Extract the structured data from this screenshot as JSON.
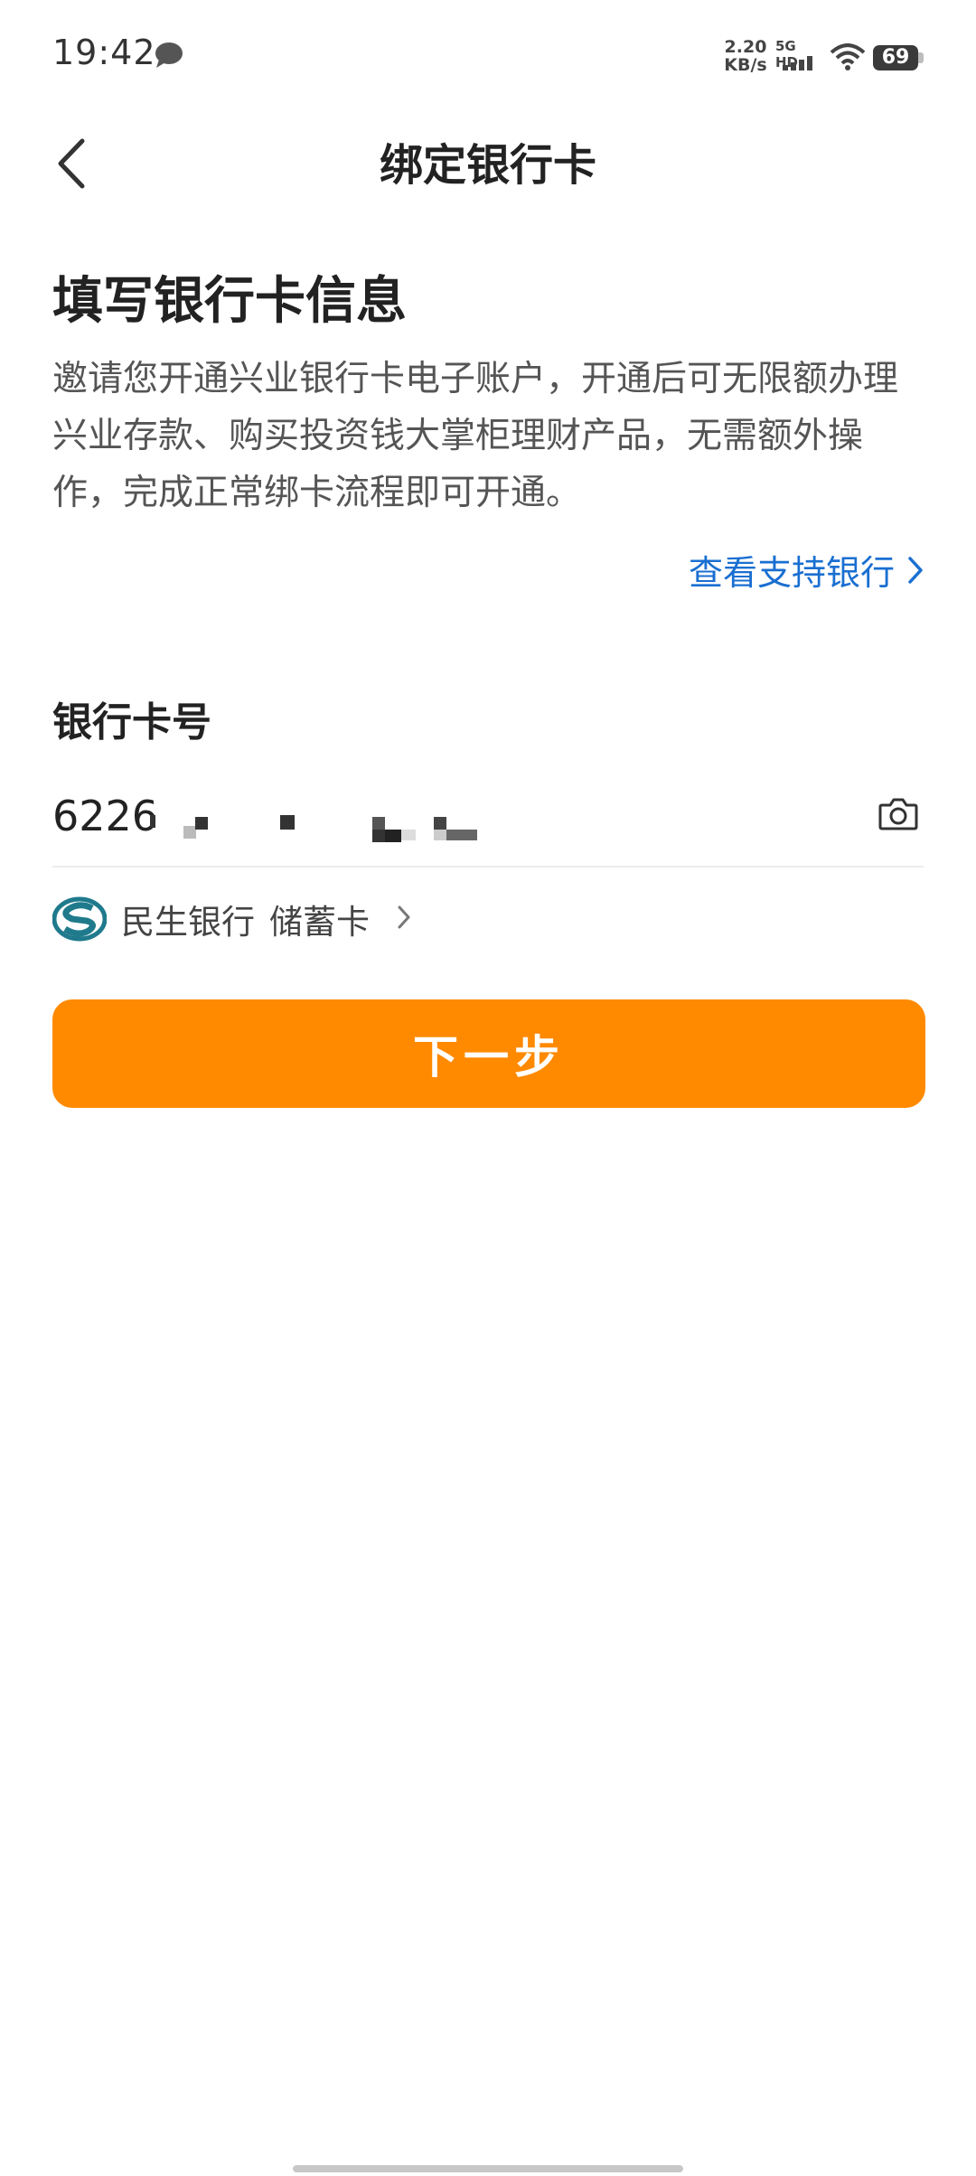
{
  "status_bar": {
    "time": "19:42",
    "net_speed_value": "2.20",
    "net_speed_unit": "KB/s",
    "network_type": "5G HD",
    "battery": "69"
  },
  "header": {
    "title": "绑定银行卡"
  },
  "main": {
    "heading": "填写银行卡信息",
    "description": "邀请您开通兴业银行卡电子账户，开通后可无限额办理兴业存款、购买投资钱大掌柜理财产品，无需额外操作，完成正常绑卡流程即可开通。",
    "support_link": "查看支持银行",
    "card_field": {
      "label": "银行卡号",
      "value": "6226"
    },
    "bank": {
      "name": "民生银行",
      "card_type": "储蓄卡"
    },
    "next_button": "下一步"
  },
  "colors": {
    "accent_orange": "#ff8a00",
    "link_blue": "#1a6fd1"
  },
  "icons": {
    "back": "chevron-left-icon",
    "camera": "camera-icon",
    "message": "message-icon",
    "wifi": "wifi-icon",
    "signal": "signal-icon",
    "bank_logo": "minsheng-bank-logo"
  }
}
